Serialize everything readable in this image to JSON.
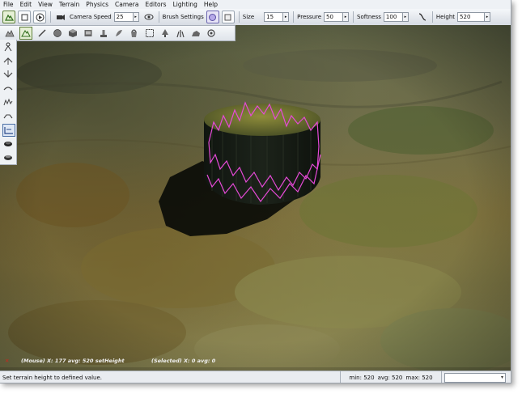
{
  "menu": [
    "File",
    "Edit",
    "View",
    "Terrain",
    "Physics",
    "Camera",
    "Editors",
    "Lighting",
    "Help"
  ],
  "toolbar": {
    "camera_speed_label": "Camera Speed",
    "camera_speed_value": "25",
    "brush_settings_label": "Brush Settings",
    "size_label": "Size",
    "size_value": "15",
    "pressure_label": "Pressure",
    "pressure_value": "50",
    "softness_label": "Softness",
    "softness_value": "100",
    "height_label": "Height",
    "height_value": "520"
  },
  "viewport": {
    "mouse_readout": "(Mouse) X: 177  avg: 520  setHeight",
    "selected_readout": "(Selected) X: 0  avg: 0"
  },
  "status": {
    "message": "Set terrain height to defined value.",
    "min": "min: 520",
    "avg": "avg: 520",
    "max": "max: 520",
    "dropdown_value": ""
  },
  "colors": {
    "brush_outline": "#e64ad8",
    "terrain": "#6f6a40"
  },
  "icons": {
    "toolbar": [
      "terrain-editor-icon",
      "record-icon",
      "play-icon",
      "camera-icon",
      "eye-icon",
      "brush-circle-icon",
      "brush-square-icon",
      "softness-curve-icon"
    ],
    "tools": [
      "raise-icon",
      "paint-icon",
      "sphere-icon",
      "cube-icon",
      "material-icon",
      "stamp-icon",
      "feather-icon",
      "bucket-icon",
      "select-box-icon",
      "tree-icon",
      "grass-icon",
      "rock-icon",
      "object-icon"
    ],
    "left": [
      "set-height-icon",
      "raise-height-icon",
      "lower-height-icon",
      "smooth-icon",
      "noise-icon",
      "flatten-icon",
      "adjust-height-icon",
      "hole-icon",
      "fill-icon"
    ]
  }
}
